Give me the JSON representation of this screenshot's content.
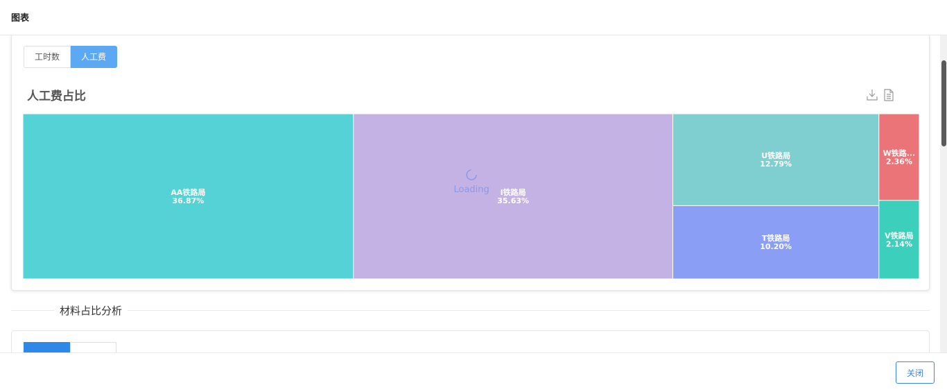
{
  "header": {
    "title": "图表"
  },
  "labor_card": {
    "tabs": [
      {
        "label": "工时数",
        "active": false
      },
      {
        "label": "人工费",
        "active": true
      }
    ],
    "chart_title": "人工费占比",
    "toolbox": {
      "download_icon": "download-icon",
      "data_view_icon": "document-icon"
    },
    "loading_text": "Loading"
  },
  "chart_data": {
    "type": "treemap",
    "title": "人工费占比",
    "items": [
      {
        "name": "AA铁路局",
        "percent": "36.87%",
        "value": 36.87,
        "color": "#55d2d5"
      },
      {
        "name": "I铁路局",
        "percent": "35.63%",
        "value": 35.63,
        "color": "#c4b2e4"
      },
      {
        "name": "U铁路局",
        "percent": "12.79%",
        "value": 12.79,
        "color": "#80cfd0"
      },
      {
        "name": "T铁路局",
        "percent": "10.20%",
        "value": 10.2,
        "color": "#8b9ef5"
      },
      {
        "name": "W铁路...",
        "percent": "2.36%",
        "value": 2.36,
        "color": "#eb7478"
      },
      {
        "name": "V铁路局",
        "percent": "2.14%",
        "value": 2.14,
        "color": "#3ccfbc"
      }
    ]
  },
  "material_section": {
    "label": "材料占比分析"
  },
  "scrollbar": {
    "position": 0.14
  },
  "footer": {
    "close_label": "关闭"
  },
  "colors": {
    "accent": "#3d86e0",
    "active_tab": "#5ca8f3"
  }
}
